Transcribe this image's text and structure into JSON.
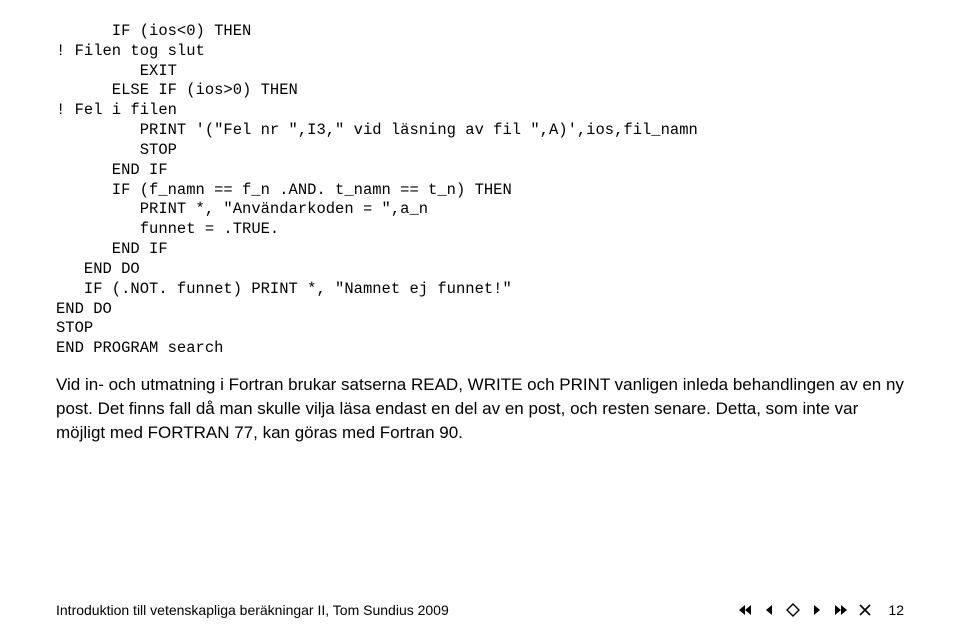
{
  "code_block": "      IF (ios<0) THEN\n! Filen tog slut\n         EXIT\n      ELSE IF (ios>0) THEN\n! Fel i filen\n         PRINT '(\"Fel nr \",I3,\" vid läsning av fil \",A)',ios,fil_namn\n         STOP\n      END IF\n      IF (f_namn == f_n .AND. t_namn == t_n) THEN\n         PRINT *, \"Användarkoden = \",a_n\n         funnet = .TRUE.\n      END IF\n   END DO\n   IF (.NOT. funnet) PRINT *, \"Namnet ej funnet!\"\nEND DO\nSTOP\nEND PROGRAM search",
  "paragraph": "Vid in- och utmatning i Fortran brukar satserna READ, WRITE och PRINT vanligen inleda behandlingen av en ny post. Det finns fall då man skulle vilja läsa endast en del av en post, och resten senare. Detta, som inte var möjligt med FORTRAN 77, kan göras med Fortran 90.",
  "footer": {
    "left": "Introduktion till vetenskapliga beräkningar II, Tom Sundius 2009",
    "page": "12"
  }
}
